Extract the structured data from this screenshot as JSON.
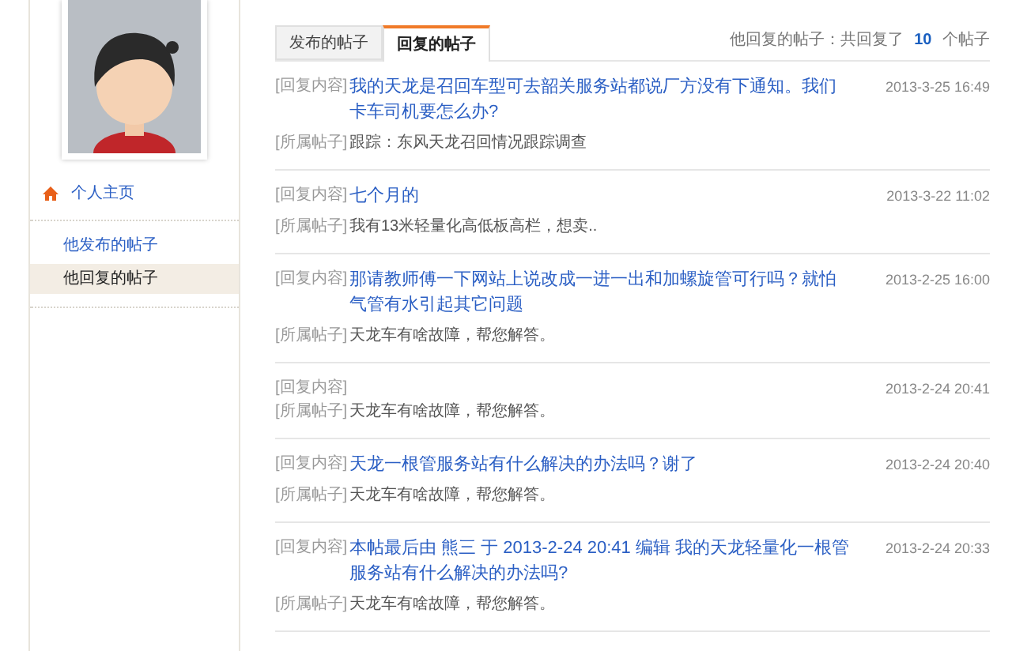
{
  "sidebar": {
    "home": "个人主页",
    "items": [
      {
        "label": "他发布的帖子",
        "selected": false
      },
      {
        "label": "他回复的帖子",
        "selected": true
      }
    ]
  },
  "tabs": [
    {
      "label": "发布的帖子",
      "selected": false
    },
    {
      "label": "回复的帖子",
      "selected": true
    }
  ],
  "summary": {
    "prefix": "他回复的帖子：共回复了",
    "count": "10",
    "suffix": "个帖子"
  },
  "posts": [
    {
      "content_label": "[回复内容]",
      "content": "我的天龙是召回车型可去韶关服务站都说厂方没有下通知。我们卡车司机要怎么办?",
      "date": "2013-3-25 16:49",
      "parent_label": "[所属帖子]",
      "parent": "跟踪：东风天龙召回情况跟踪调查"
    },
    {
      "content_label": "[回复内容]",
      "content": "七个月的",
      "date": "2013-3-22 11:02",
      "parent_label": "[所属帖子]",
      "parent": "我有13米轻量化高低板高栏，想卖.."
    },
    {
      "content_label": "[回复内容]",
      "content": "那请教师傅一下网站上说改成一进一出和加螺旋管可行吗？就怕气管有水引起其它问题",
      "date": "2013-2-25 16:00",
      "parent_label": "[所属帖子]",
      "parent": "天龙车有啥故障，帮您解答。"
    },
    {
      "content_label": "[回复内容]",
      "date": "2013-2-24 20:41",
      "parent_label": "[所属帖子]",
      "parent": "天龙车有啥故障，帮您解答。"
    },
    {
      "content_label": "[回复内容]",
      "content": "天龙一根管服务站有什么解决的办法吗？谢了",
      "date": "2013-2-24 20:40",
      "parent_label": "[所属帖子]",
      "parent": "天龙车有啥故障，帮您解答。"
    },
    {
      "content_label": "[回复内容]",
      "content": "本帖最后由 熊三 于 2013-2-24 20:41 编辑 我的天龙轻量化一根管服务站有什么解决的办法吗?",
      "date": "2013-2-24 20:33",
      "parent_label": "[所属帖子]",
      "parent": "天龙车有啥故障，帮您解答。"
    }
  ]
}
